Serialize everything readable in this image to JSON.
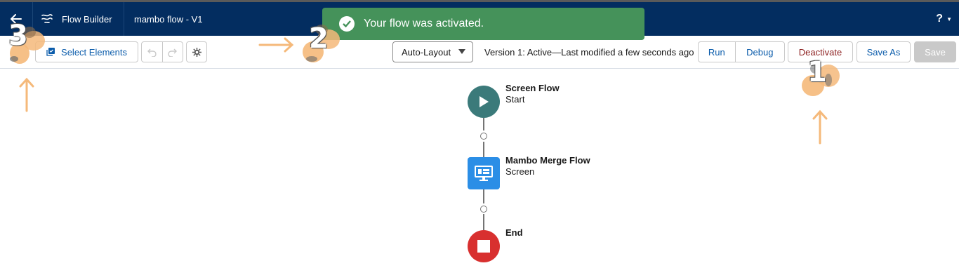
{
  "header": {
    "app_name": "Flow Builder",
    "flow_title": "mambo flow - V1",
    "help_label": "?",
    "colors": {
      "background": "#032d60",
      "text": "#ffffff"
    }
  },
  "toolbar": {
    "select_elements_label": "Select Elements",
    "layout_select_value": "Auto-Layout",
    "version_text": "Version 1: Active—Last modified a few seconds ago",
    "run_label": "Run",
    "debug_label": "Debug",
    "deactivate_label": "Deactivate",
    "save_as_label": "Save As",
    "save_label": "Save"
  },
  "toast": {
    "message": "Your flow was activated.",
    "color": "#45925a"
  },
  "flow": {
    "start": {
      "title": "Screen Flow",
      "subtitle": "Start",
      "color": "#3b7a7a",
      "icon": "play-icon"
    },
    "screen": {
      "title": "Mambo Merge Flow",
      "subtitle": "Screen",
      "color": "#2b8ee6",
      "icon": "screen-icon"
    },
    "end": {
      "title": "End",
      "color": "#d8302f",
      "icon": "stop-icon"
    }
  },
  "annotations": {
    "markers": [
      "3",
      "2",
      "1"
    ],
    "color": "#f5b97a"
  }
}
